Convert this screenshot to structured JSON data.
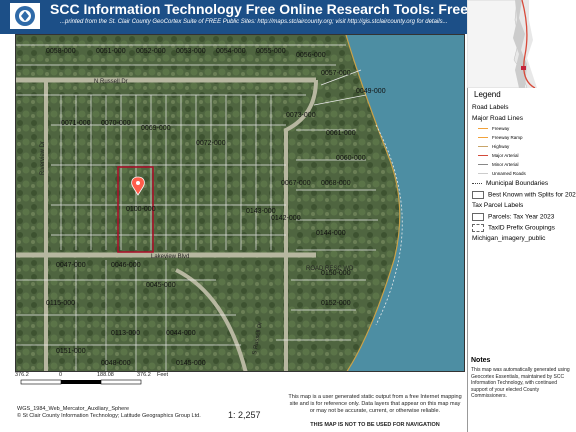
{
  "header": {
    "title": "SCC Information Technology Free Online Research Tools: Free Printed Map",
    "subtitle": "...printed from the St. Clair County GeoCortex Suite of FREE Public Sites: http://maps.stclaircounty.org; visit http://gis.stclaircounty.org for details..."
  },
  "colors": {
    "header_bg": "#1c4f87",
    "parcel_line": "#e8e8e8",
    "selected_parcel": "#a8132b",
    "water": "#4d8ea3",
    "label_orange": "#c9a24a"
  },
  "map": {
    "road_labels": [
      "N Russell Dr",
      "Riverview Dr",
      "Lakeview Blvd",
      "S Russell Dr"
    ],
    "parcel_labels": [
      "0058-000",
      "0051-000",
      "0052-000",
      "0053-000",
      "0054-000",
      "0055-000",
      "0056-000",
      "0057-000",
      "0049-000",
      "0071-000",
      "0070-000",
      "0069-000",
      "0072-000",
      "0073-000",
      "0061-000",
      "0060-000",
      "0068-000",
      "0067-000",
      "0100-000",
      "0142-000",
      "0143-000",
      "0144-000",
      "0150-000",
      "0152-000",
      "0047-000",
      "0046-000",
      "0045-000",
      "0044-000",
      "0113-000",
      "0115-000",
      "0151-000",
      "0145-000",
      "0048-000"
    ],
    "shore_note": "ROAD RESC WD",
    "icons": [
      "location-pin-icon"
    ]
  },
  "legend": {
    "title": "Legend",
    "groups": [
      {
        "label": "Road Labels",
        "icon": "none"
      },
      {
        "label": "Major Road Lines",
        "icon": "none"
      },
      {
        "label": "Freeway",
        "icon": "line-orange",
        "sub": true
      },
      {
        "label": "Freeway Ramp",
        "icon": "line-orange",
        "sub": true
      },
      {
        "label": "Highway",
        "icon": "line-tan",
        "sub": true
      },
      {
        "label": "Major Arterial",
        "icon": "line-red",
        "sub": true
      },
      {
        "label": "Minor Arterial",
        "icon": "line-gray",
        "sub": true
      },
      {
        "label": "Unnamed Roads",
        "icon": "line-light",
        "sub": true
      },
      {
        "label": "Municipal Boundaries",
        "icon": "dots"
      },
      {
        "label": "Best Known with Splits for 202",
        "icon": "box-gray"
      },
      {
        "label": "Tax Parcel Labels",
        "icon": "none"
      },
      {
        "label": "Parcels: Tax Year 2023",
        "icon": "box-gray"
      },
      {
        "label": "TaxID Prefix Groupings",
        "icon": "dash-box"
      },
      {
        "label": "Michigan_imagery_public",
        "icon": "none"
      }
    ]
  },
  "notes": {
    "title": "Notes",
    "text": "This map was automatically generated using Geocortex Essentials, maintained by SCC Information Technology, with continued support of your elected County Commissioners."
  },
  "footer": {
    "scale_ticks": [
      "376.2",
      "0",
      "188.08",
      "376.2"
    ],
    "scale_unit": "Feet",
    "projection": "WGS_1984_Web_Mercator_Auxiliary_Sphere",
    "copyright": "© St Clair County Information Technology; Latitude Geographics Group Ltd.",
    "scale_ratio": "1: 2,257",
    "disclaimer": "This map is a user generated static output from a free Internet mapping site and is for reference only. Data layers that appear on this map may or may not be accurate, current, or otherwise reliable.",
    "navigation_warning": "THIS MAP IS NOT TO BE USED FOR NAVIGATION"
  }
}
